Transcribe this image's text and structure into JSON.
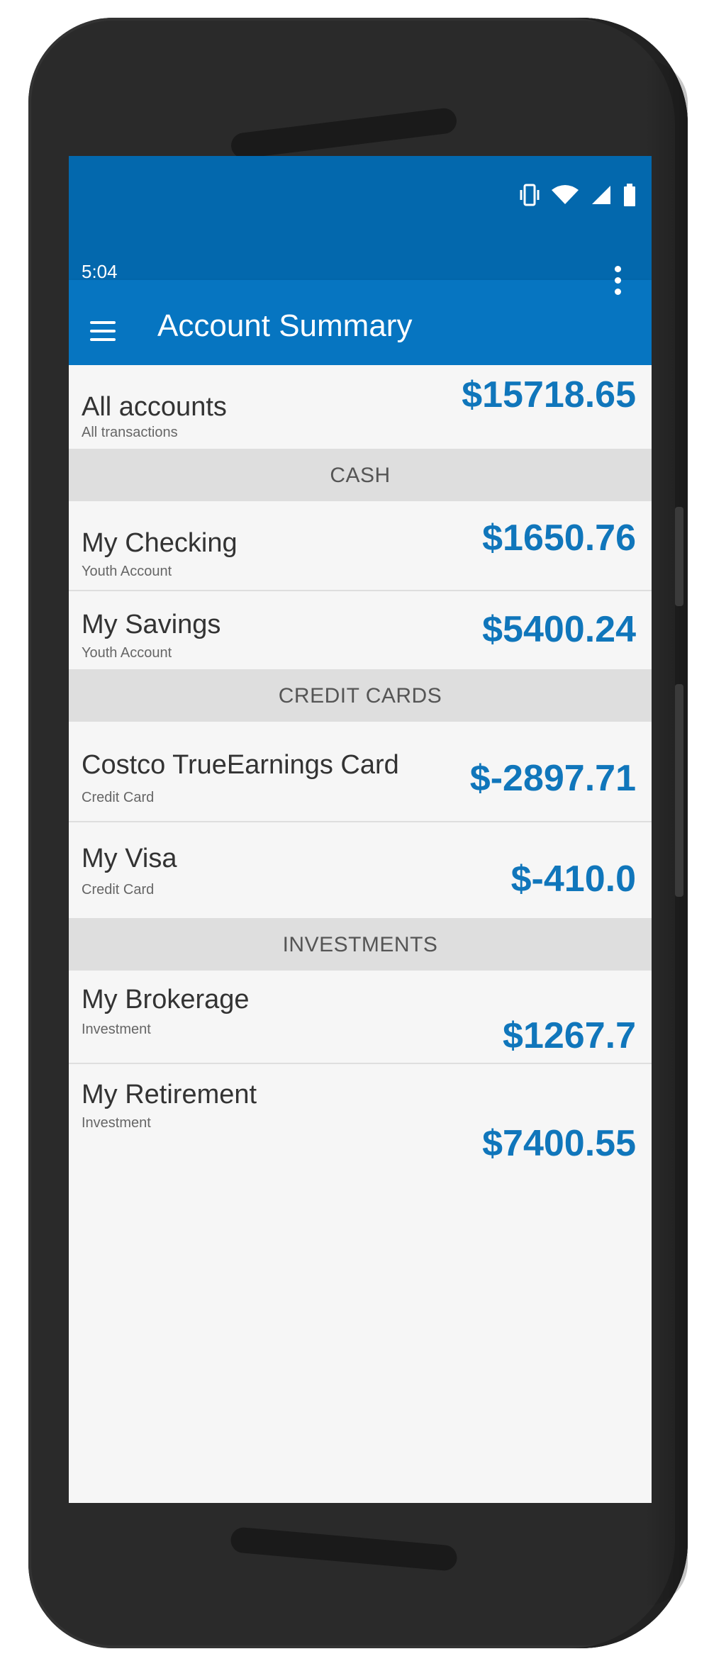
{
  "status": {
    "time": "5:04"
  },
  "appbar": {
    "title": "Account Summary"
  },
  "all_accounts": {
    "title": "All accounts",
    "subtitle": "All transactions",
    "amount": "$15718.65"
  },
  "sections": [
    {
      "label": "CASH",
      "accounts": [
        {
          "name": "My Checking",
          "type": "Youth Account",
          "amount": "$1650.76"
        },
        {
          "name": "My Savings",
          "type": "Youth Account",
          "amount": "$5400.24"
        }
      ]
    },
    {
      "label": "CREDIT CARDS",
      "accounts": [
        {
          "name": "Costco TrueEarnings Card",
          "type": "Credit Card",
          "amount": "$-2897.71"
        },
        {
          "name": "My Visa",
          "type": "Credit Card",
          "amount": "$-410.0"
        }
      ]
    },
    {
      "label": "INVESTMENTS",
      "accounts": [
        {
          "name": "My Brokerage",
          "type": "Investment",
          "amount": "$1267.7"
        },
        {
          "name": "My Retirement",
          "type": "Investment",
          "amount": "$7400.55"
        }
      ]
    }
  ],
  "colors": {
    "statusbar": "#0368ad",
    "appbar": "#0675c1",
    "amount": "#1076bb",
    "section_bg": "#dedede"
  },
  "icons": [
    "vibrate-icon",
    "wifi-icon",
    "signal-icon",
    "battery-icon",
    "menu-icon",
    "overflow-icon"
  ]
}
